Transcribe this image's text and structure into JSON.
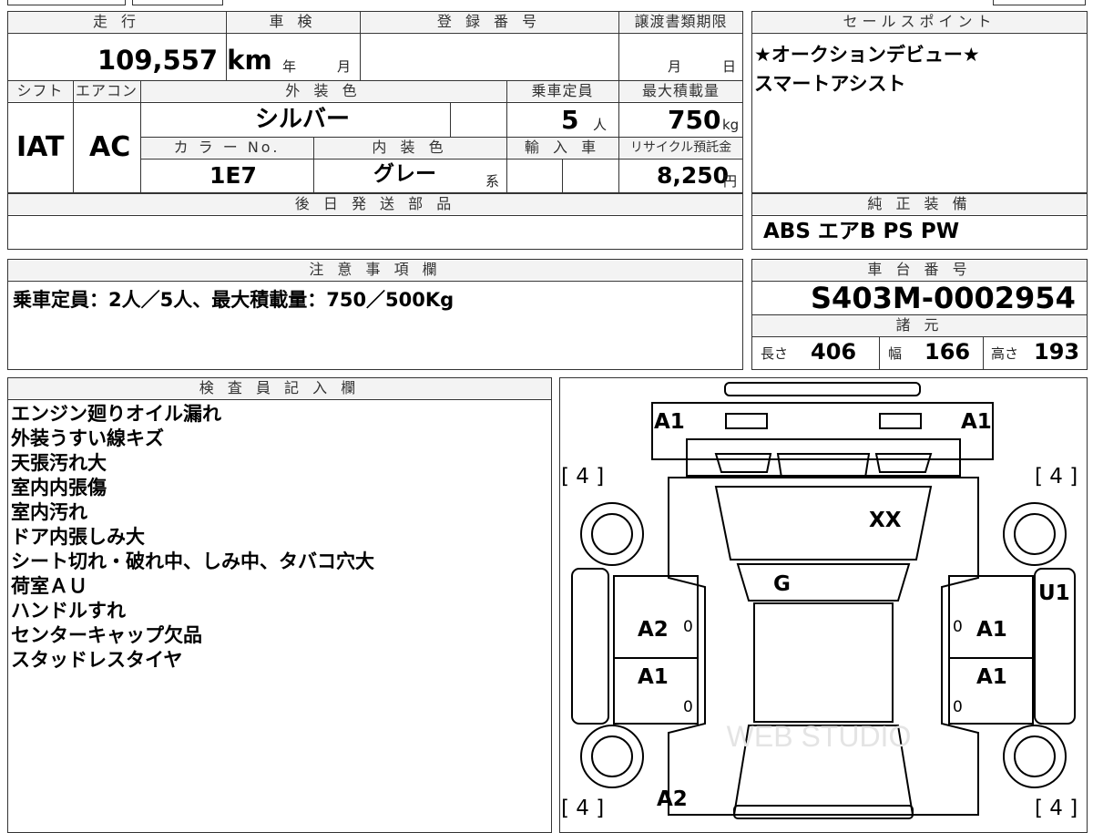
{
  "labels": {
    "mileage": "走 行",
    "inspection": "車 検",
    "registration": "登 録 番 号",
    "transfer_deadline": "譲渡書類期限",
    "sales_point": "セールスポイント",
    "shift": "シフト",
    "aircon": "エアコン",
    "exterior_color": "外 装 色",
    "capacity": "乗車定員",
    "max_load": "最大積載量",
    "color_no": "カ ラ ー No.",
    "interior_color": "内 装 色",
    "import_car": "輸 入 車",
    "recycle_fee": "リサイクル預託金",
    "later_parts": "後 日 発 送 部 品",
    "factory_equipment": "純 正 装 備",
    "notes": "注 意 事 項 欄",
    "chassis_no": "車 台 番 号",
    "specs": "諸 元",
    "inspector_notes": "検 査 員 記 入 欄"
  },
  "values": {
    "mileage": "109,557 km",
    "year_label": "年",
    "month_label": "月",
    "transfer_month": "月",
    "transfer_day": "日",
    "shift": "IAT",
    "aircon": "AC",
    "exterior_color": "シルバー",
    "capacity": "5",
    "capacity_unit": "人",
    "max_load": "750",
    "max_load_unit": "kg",
    "color_no": "1E7",
    "interior_color": "グレー",
    "interior_suffix": "系",
    "recycle_fee": "8,250",
    "recycle_unit": "円",
    "sales_points": [
      "★オークションデビュー★",
      "スマートアシスト"
    ],
    "equipment": "ABS エアB PS PW",
    "notes": "乗車定員：2人／5人、最大積載量：750／500Kg",
    "chassis_no": "S403M-0002954",
    "length_label": "長さ",
    "length": "406",
    "width_label": "幅",
    "width": "166",
    "height_label": "高さ",
    "height": "193"
  },
  "inspector_notes": [
    "エンジン廻りオイル漏れ",
    "外装うすい線キズ",
    "天張汚れ大",
    "室内内張傷",
    "室内汚れ",
    "ドア内張しみ大",
    "シート切れ・破れ中、しみ中、タバコ穴大",
    "荷室ＡＵ",
    "ハンドルすれ",
    "センターキャップ欠品",
    "スタッドレスタイヤ"
  ],
  "diagram_marks": {
    "front_left": "A1",
    "front_right": "A1",
    "roof": "XX",
    "windshield": "G",
    "right_panel": "U1",
    "door_fl": "A2",
    "door_fr": "A1",
    "door_rl": "A1",
    "door_rr": "A1",
    "rear": "A2",
    "tire_fl": "[ 4 ]",
    "tire_fr": "[ 4 ]",
    "tire_rl": "[ 4 ]",
    "tire_rr": "[ 4 ]",
    "door_small": "0"
  },
  "watermark": "WEB STUDIO"
}
